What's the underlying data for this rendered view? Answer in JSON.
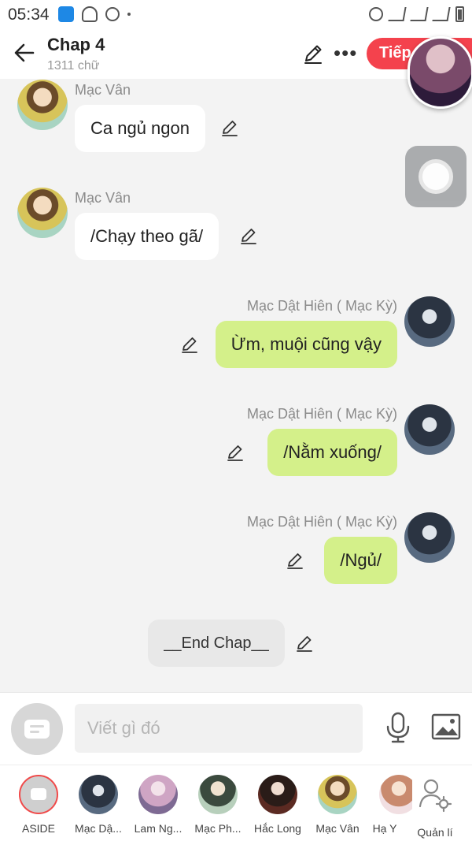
{
  "status_bar": {
    "time": "05:34"
  },
  "header": {
    "title": "Chap 4",
    "word_count": "1311 chữ",
    "next_label": "Tiếp"
  },
  "messages": [
    {
      "side": "left",
      "sender": "Mạc Vân",
      "text": "Ca ngủ ngon"
    },
    {
      "side": "left",
      "sender": "Mạc Vân",
      "text": "/Chạy theo gã/"
    },
    {
      "side": "right",
      "sender": "Mạc Dật Hiên ( Mạc Kỳ)",
      "text": "Ừm, muội cũng vậy"
    },
    {
      "side": "right",
      "sender": "Mạc Dật Hiên ( Mạc Kỳ)",
      "text": "/Nằm xuống/"
    },
    {
      "side": "right",
      "sender": "Mạc Dật Hiên ( Mạc Kỳ)",
      "text": "/Ngủ/"
    },
    {
      "side": "aside",
      "sender": "",
      "text": "__End Chap__"
    }
  ],
  "input": {
    "placeholder": "Viết gì đó"
  },
  "characters": [
    {
      "label": "ASIDE"
    },
    {
      "label": "Mạc Dậ..."
    },
    {
      "label": "Lam Ng..."
    },
    {
      "label": "Mạc Ph..."
    },
    {
      "label": "Hắc Long"
    },
    {
      "label": "Mạc Vân"
    },
    {
      "label": "Hạ Y"
    },
    {
      "label": "Quản lí"
    }
  ],
  "colors": {
    "accent": "#f4424d",
    "right_bubble": "#d4f08a",
    "left_bubble": "#ffffff",
    "aside_bubble": "#e8e8e8"
  }
}
